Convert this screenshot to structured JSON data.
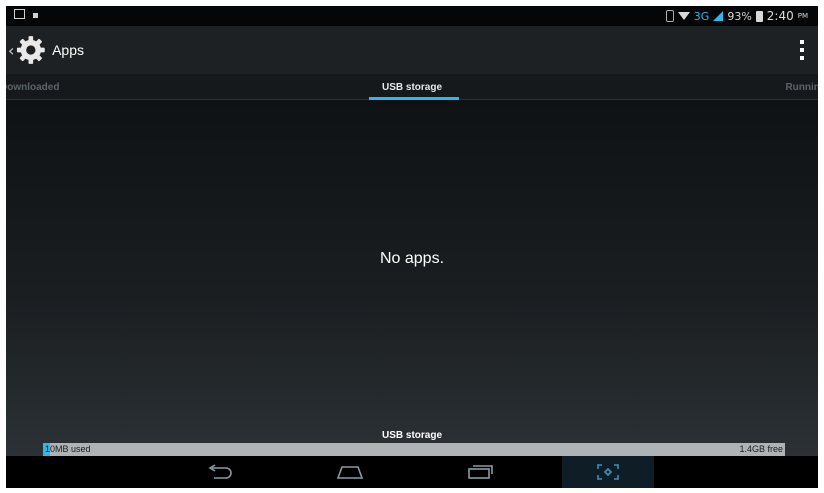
{
  "status_bar": {
    "network": "3G",
    "battery": "93%",
    "time": "2:40",
    "ampm": "PM"
  },
  "action_bar": {
    "title": "Apps",
    "icons": {
      "up": "chevron-left-icon",
      "app": "gear-icon",
      "overflow": "overflow-menu-icon"
    }
  },
  "tabs": [
    {
      "label": "Downloaded"
    },
    {
      "label": "USB storage"
    },
    {
      "label": "Running"
    }
  ],
  "content": {
    "empty_message": "No apps.",
    "storage": {
      "label": "USB storage",
      "used": "10MB used",
      "free": "1.4GB free",
      "used_fraction": 0.01
    }
  },
  "nav_bar": {
    "icons": [
      "back-icon",
      "home-icon",
      "recents-icon",
      "screenshot-icon"
    ]
  },
  "colors": {
    "accent": "#33b5e5",
    "background": "#0f1214",
    "action_bar": "#1d2123"
  }
}
